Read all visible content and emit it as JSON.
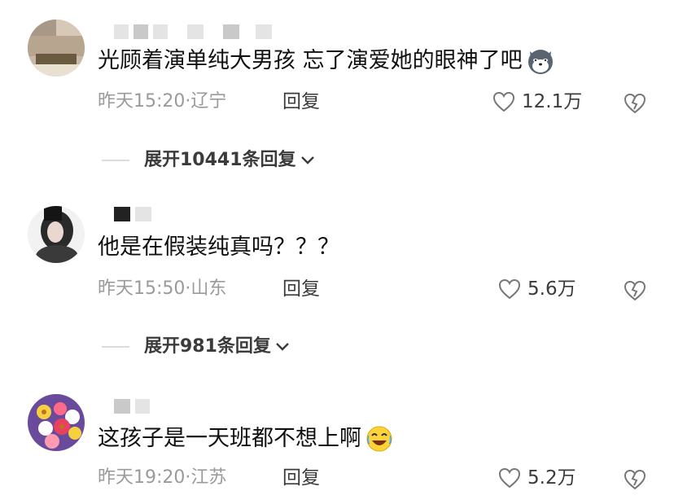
{
  "comments": [
    {
      "text": "光顾着演单纯大男孩  忘了演爱她的眼神了吧",
      "emoji": "husky-dog-emoji",
      "time": "昨天15:20",
      "location": "辽宁",
      "reply_label": "回复",
      "likes": "12.1万",
      "expand_label": "展开10441条回复"
    },
    {
      "text": "他是在假装纯真吗？？？",
      "emoji": "",
      "time": "昨天15:50",
      "location": "山东",
      "reply_label": "回复",
      "likes": "5.6万",
      "expand_label": "展开981条回复"
    },
    {
      "text": "这孩子是一天班都不想上啊",
      "emoji": "crying-laughing-emoji",
      "time": "昨天19:20",
      "location": "江苏",
      "reply_label": "回复",
      "likes": "5.2万",
      "expand_label": ""
    }
  ],
  "meta_separator": "·",
  "colors": {
    "text": "#111111",
    "meta": "#9a9a9a",
    "action": "#3b3b3b"
  }
}
